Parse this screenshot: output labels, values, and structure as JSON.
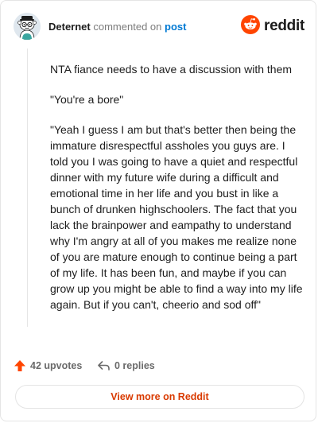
{
  "header": {
    "username": "Deternet",
    "action_text": "commented on",
    "post_link": "post",
    "brand": "reddit",
    "avatar_icon": "snoo-avatar-icon",
    "brand_icon": "reddit-logo-icon",
    "brand_color": "#ff4500"
  },
  "comment": {
    "paragraphs": [
      "NTA fiance needs to have a discussion with them",
      "\"You're a bore\"",
      "\"Yeah I guess I am but that's better then being the immature disrespectful assholes you guys are. I told you I was going to have a quiet and respectful dinner with my future wife during a difficult and emotional time in her life and you bust in like a bunch of drunken highschoolers. The fact that you lack the brainpower and eampathy to understand why I'm angry at all of you makes me realize none of you are mature enough to continue being a part of my life. It has been fun, and maybe if you can grow up you might be able to find a way into my life again. But if you can't, cheerio and sod off\""
    ]
  },
  "actions": {
    "upvotes": "42 upvotes",
    "upvote_icon": "upvote-arrow-icon",
    "upvote_color": "#ff4500",
    "replies": "0 replies",
    "reply_icon": "reply-arrow-icon"
  },
  "footer": {
    "view_more": "View more on Reddit",
    "link_color": "#d93a00"
  }
}
